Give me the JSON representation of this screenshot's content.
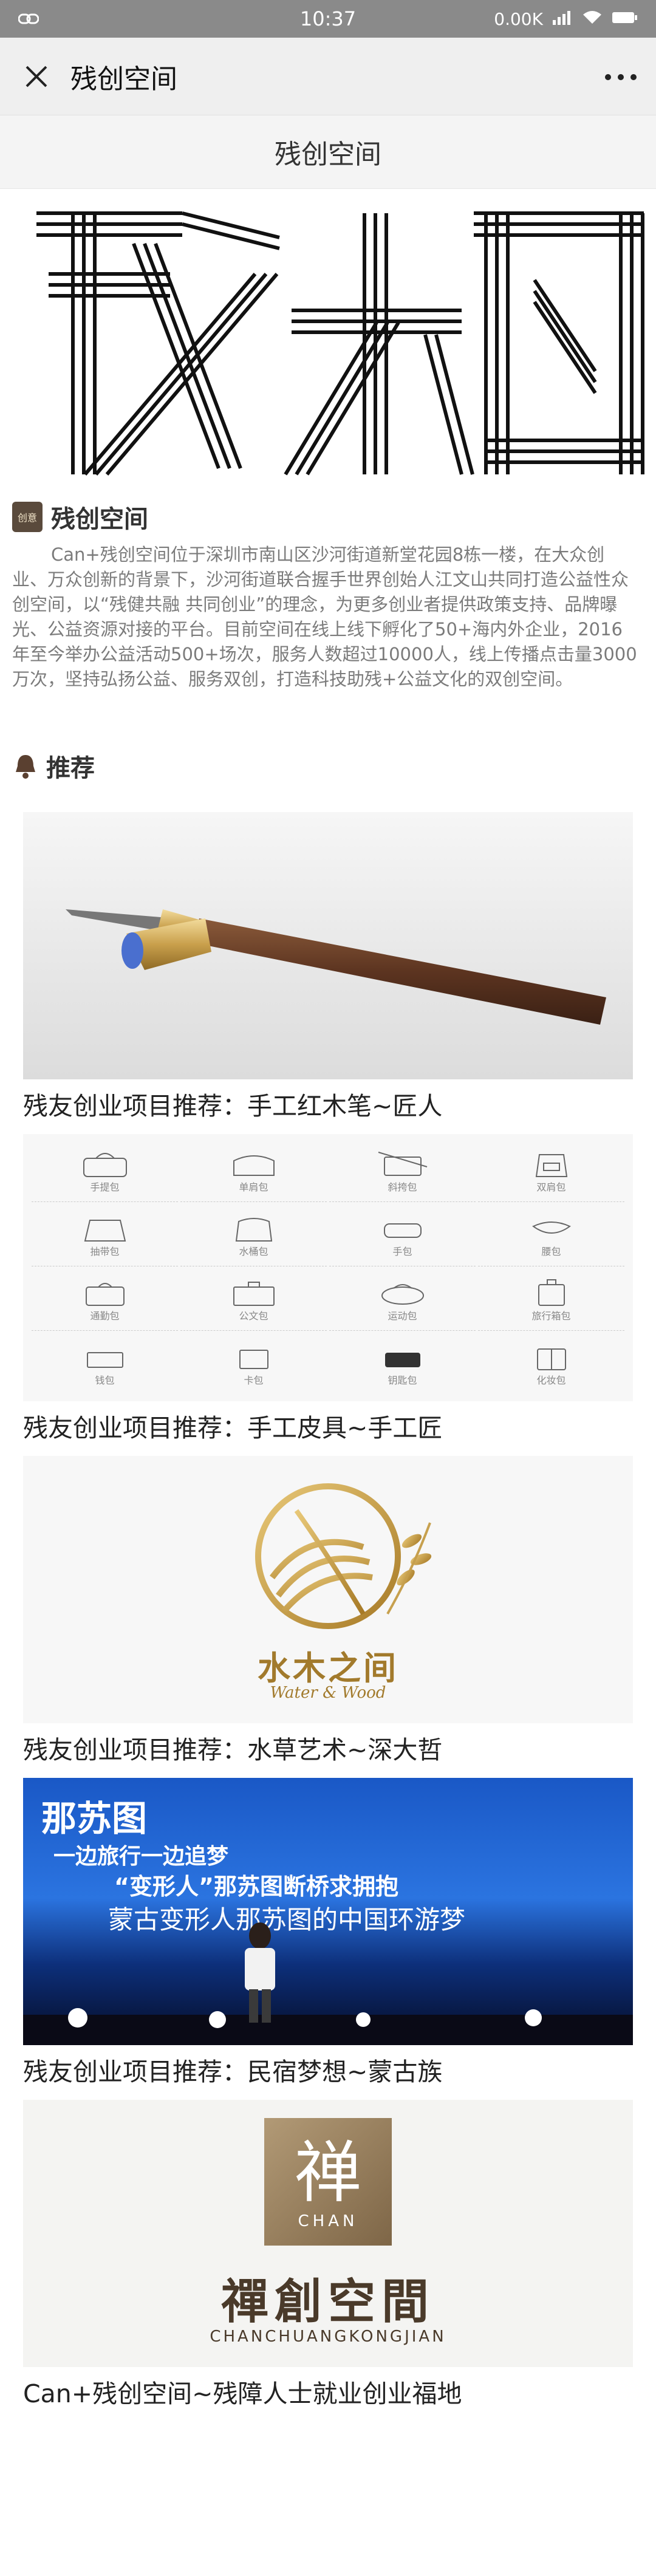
{
  "status_bar": {
    "time": "10:37",
    "speed": "0.00K"
  },
  "nav": {
    "title": "残创空间"
  },
  "page": {
    "title": "残创空间"
  },
  "banner": {
    "text": "残创"
  },
  "intro_section": {
    "badge_text": "创意",
    "title": "残创空间",
    "body": "Can+残创空间位于深圳市南山区沙河街道新堂花园8栋一楼，在大众创业、万众创新的背景下，沙河街道联合握手世界创始人江文山共同打造公益性众创空间，以“残健共融 共同创业”的理念，为更多创业者提供政策支持、品牌曝光、公益资源对接的平台。目前空间在线上线下孵化了50+海内外企业，2016年至今举办公益活动500+场次，服务人数超过10000人，线上传播点击量3000万次，坚持弘扬公益、服务双创，打造科技助残+公益文化的双创空间。"
  },
  "recommend": {
    "title": "推荐",
    "items": [
      {
        "caption": "残友创业项目推荐：手工红木笔~匠人"
      },
      {
        "caption": "残友创业项目推荐：手工皮具~手工匠",
        "bag_labels": [
          "手提包",
          "单肩包",
          "斜挎包",
          "双肩包",
          "抽带包",
          "水桶包",
          "手包",
          "腰包",
          "通勤包",
          "公文包",
          "运动包",
          "旅行箱包",
          "钱包",
          "卡包",
          "钥匙包",
          "化妆包"
        ]
      },
      {
        "caption": "残友创业项目推荐：水草艺术~深大哲",
        "logo_cn": "水木之间",
        "logo_en": "Water & Wood"
      },
      {
        "caption": "残友创业项目推荐：民宿梦想~蒙古族",
        "stage_line1": "那苏图",
        "stage_line2": "一边旅行一边追梦",
        "stage_line3": "“变形人”那苏图断桥求拥抱",
        "stage_line4": "蒙古变形人那苏图的中国环游梦"
      },
      {
        "caption": "Can+残创空间~残障人士就业创业福地",
        "seal_char": "禅",
        "seal_en": "CHAN",
        "brand_cn": "禪創空間",
        "brand_en": "CHANCHUANGKONGJIAN"
      }
    ]
  }
}
